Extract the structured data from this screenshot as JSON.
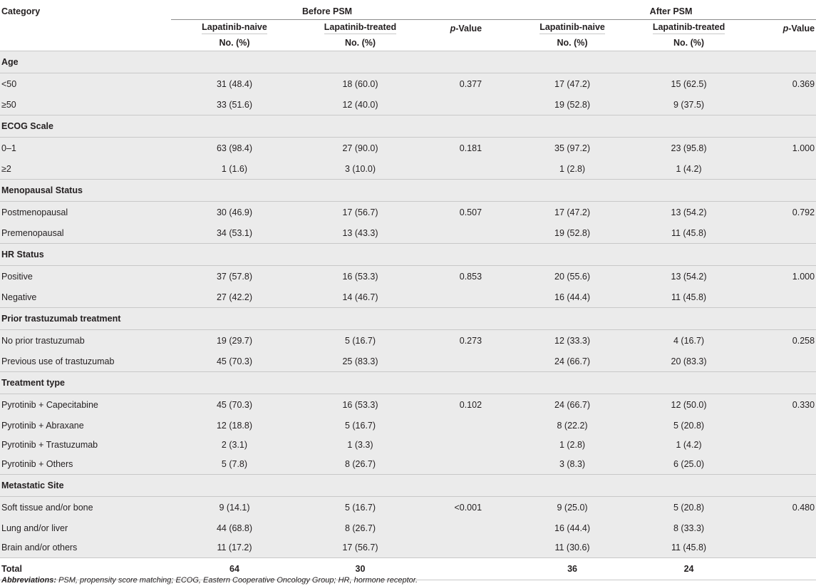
{
  "header": {
    "category_label": "Category",
    "before_label": "Before PSM",
    "after_label": "After PSM",
    "naive_label": "Lapatinib-naive",
    "treated_label": "Lapatinib-treated",
    "p_label_italic": "p",
    "p_label_rest": "-Value",
    "unit_label": "No. (%)"
  },
  "sections": [
    {
      "title": "Age",
      "rows": [
        {
          "label": "<50",
          "b_naive": "31 (48.4)",
          "b_treated": "18 (60.0)",
          "b_p": "0.377",
          "a_naive": "17 (47.2)",
          "a_treated": "15 (62.5)",
          "a_p": "0.369"
        },
        {
          "label": "≥50",
          "b_naive": "33 (51.6)",
          "b_treated": "12 (40.0)",
          "b_p": "",
          "a_naive": "19 (52.8)",
          "a_treated": "9 (37.5)",
          "a_p": ""
        }
      ]
    },
    {
      "title": "ECOG Scale",
      "rows": [
        {
          "label": "0–1",
          "b_naive": "63 (98.4)",
          "b_treated": "27 (90.0)",
          "b_p": "0.181",
          "a_naive": "35 (97.2)",
          "a_treated": "23 (95.8)",
          "a_p": "1.000"
        },
        {
          "label": "≥2",
          "b_naive": "1 (1.6)",
          "b_treated": "3 (10.0)",
          "b_p": "",
          "a_naive": "1 (2.8)",
          "a_treated": "1 (4.2)",
          "a_p": ""
        }
      ]
    },
    {
      "title": "Menopausal Status",
      "rows": [
        {
          "label": "Postmenopausal",
          "b_naive": "30 (46.9)",
          "b_treated": "17 (56.7)",
          "b_p": "0.507",
          "a_naive": "17 (47.2)",
          "a_treated": "13 (54.2)",
          "a_p": "0.792"
        },
        {
          "label": "Premenopausal",
          "b_naive": "34 (53.1)",
          "b_treated": "13 (43.3)",
          "b_p": "",
          "a_naive": "19 (52.8)",
          "a_treated": "11 (45.8)",
          "a_p": ""
        }
      ]
    },
    {
      "title": "HR Status",
      "rows": [
        {
          "label": "Positive",
          "b_naive": "37 (57.8)",
          "b_treated": "16 (53.3)",
          "b_p": "0.853",
          "a_naive": "20 (55.6)",
          "a_treated": "13 (54.2)",
          "a_p": "1.000"
        },
        {
          "label": "Negative",
          "b_naive": "27 (42.2)",
          "b_treated": "14 (46.7)",
          "b_p": "",
          "a_naive": "16 (44.4)",
          "a_treated": "11 (45.8)",
          "a_p": ""
        }
      ]
    },
    {
      "title": "Prior trastuzumab treatment",
      "rows": [
        {
          "label": "No prior trastuzumab",
          "b_naive": "19 (29.7)",
          "b_treated": "5 (16.7)",
          "b_p": "0.273",
          "a_naive": "12 (33.3)",
          "a_treated": "4 (16.7)",
          "a_p": "0.258"
        },
        {
          "label": "Previous use of trastuzumab",
          "b_naive": "45 (70.3)",
          "b_treated": "25 (83.3)",
          "b_p": "",
          "a_naive": "24 (66.7)",
          "a_treated": "20 (83.3)",
          "a_p": ""
        }
      ]
    },
    {
      "title": "Treatment type",
      "rows": [
        {
          "label": "Pyrotinib + Capecitabine",
          "b_naive": "45 (70.3)",
          "b_treated": "16 (53.3)",
          "b_p": "0.102",
          "a_naive": "24 (66.7)",
          "a_treated": "12 (50.0)",
          "a_p": "0.330"
        },
        {
          "label": "Pyrotinib + Abraxane",
          "b_naive": "12 (18.8)",
          "b_treated": "5 (16.7)",
          "b_p": "",
          "a_naive": "8 (22.2)",
          "a_treated": "5 (20.8)",
          "a_p": ""
        },
        {
          "label": "Pyrotinib + Trastuzumab",
          "b_naive": "2 (3.1)",
          "b_treated": "1 (3.3)",
          "b_p": "",
          "a_naive": "1 (2.8)",
          "a_treated": "1 (4.2)",
          "a_p": ""
        },
        {
          "label": "Pyrotinib + Others",
          "b_naive": "5 (7.8)",
          "b_treated": "8 (26.7)",
          "b_p": "",
          "a_naive": "3 (8.3)",
          "a_treated": "6 (25.0)",
          "a_p": ""
        }
      ]
    },
    {
      "title": "Metastatic Site",
      "rows": [
        {
          "label": "Soft tissue and/or bone",
          "b_naive": "9 (14.1)",
          "b_treated": "5 (16.7)",
          "b_p": "<0.001",
          "a_naive": "9 (25.0)",
          "a_treated": "5 (20.8)",
          "a_p": "0.480"
        },
        {
          "label": "Lung and/or liver",
          "b_naive": "44 (68.8)",
          "b_treated": "8 (26.7)",
          "b_p": "",
          "a_naive": "16 (44.4)",
          "a_treated": "8 (33.3)",
          "a_p": ""
        },
        {
          "label": "Brain and/or others",
          "b_naive": "11 (17.2)",
          "b_treated": "17 (56.7)",
          "b_p": "",
          "a_naive": "11 (30.6)",
          "a_treated": "11 (45.8)",
          "a_p": ""
        }
      ]
    }
  ],
  "total": {
    "label": "Total",
    "b_naive": "64",
    "b_treated": "30",
    "a_naive": "36",
    "a_treated": "24"
  },
  "footnote": {
    "label": "Abbreviations:",
    "text": " PSM, propensity score matching; ECOG, Eastern Cooperative Oncology Group; HR, hormone receptor."
  }
}
